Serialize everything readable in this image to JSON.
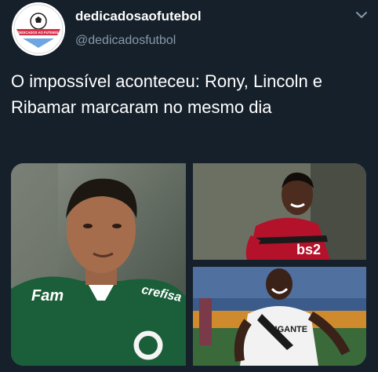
{
  "tweet": {
    "author_name": "dedicadosaofutebol",
    "author_handle": "@dedicadosfutbol",
    "avatar_text": "DEDICADOS AO FUTEBOL",
    "text": "O impossível aconteceu: Rony, Lincoln e Ribamar marcaram no mesmo dia",
    "menu_icon": "chevron-down-icon"
  },
  "media": {
    "photo1_shirt": [
      "Fam",
      "crefisa"
    ],
    "photo2_shirt": [
      "bs2"
    ],
    "photo3_shirt": [
      "GIGANTE"
    ]
  },
  "colors": {
    "background": "#15202b",
    "text": "#ffffff",
    "secondary_text": "#8899a6",
    "palmeiras_green": "#1b5e3a",
    "flamengo_red": "#b3122a",
    "vasco_white": "#f2f2f2"
  }
}
